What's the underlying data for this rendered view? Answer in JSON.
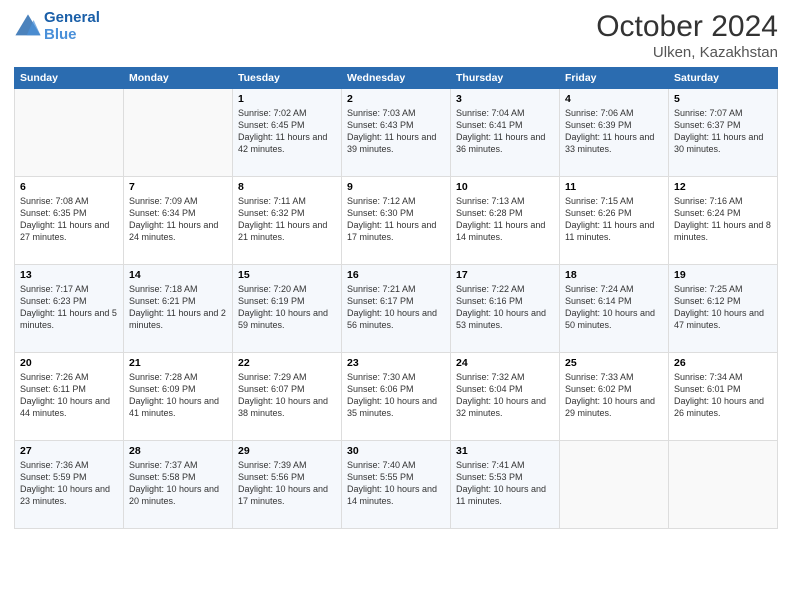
{
  "header": {
    "logo_line1": "General",
    "logo_line2": "Blue",
    "month": "October 2024",
    "location": "Ulken, Kazakhstan"
  },
  "days_of_week": [
    "Sunday",
    "Monday",
    "Tuesday",
    "Wednesday",
    "Thursday",
    "Friday",
    "Saturday"
  ],
  "weeks": [
    [
      {
        "num": "",
        "info": ""
      },
      {
        "num": "",
        "info": ""
      },
      {
        "num": "1",
        "info": "Sunrise: 7:02 AM\nSunset: 6:45 PM\nDaylight: 11 hours and 42 minutes."
      },
      {
        "num": "2",
        "info": "Sunrise: 7:03 AM\nSunset: 6:43 PM\nDaylight: 11 hours and 39 minutes."
      },
      {
        "num": "3",
        "info": "Sunrise: 7:04 AM\nSunset: 6:41 PM\nDaylight: 11 hours and 36 minutes."
      },
      {
        "num": "4",
        "info": "Sunrise: 7:06 AM\nSunset: 6:39 PM\nDaylight: 11 hours and 33 minutes."
      },
      {
        "num": "5",
        "info": "Sunrise: 7:07 AM\nSunset: 6:37 PM\nDaylight: 11 hours and 30 minutes."
      }
    ],
    [
      {
        "num": "6",
        "info": "Sunrise: 7:08 AM\nSunset: 6:35 PM\nDaylight: 11 hours and 27 minutes."
      },
      {
        "num": "7",
        "info": "Sunrise: 7:09 AM\nSunset: 6:34 PM\nDaylight: 11 hours and 24 minutes."
      },
      {
        "num": "8",
        "info": "Sunrise: 7:11 AM\nSunset: 6:32 PM\nDaylight: 11 hours and 21 minutes."
      },
      {
        "num": "9",
        "info": "Sunrise: 7:12 AM\nSunset: 6:30 PM\nDaylight: 11 hours and 17 minutes."
      },
      {
        "num": "10",
        "info": "Sunrise: 7:13 AM\nSunset: 6:28 PM\nDaylight: 11 hours and 14 minutes."
      },
      {
        "num": "11",
        "info": "Sunrise: 7:15 AM\nSunset: 6:26 PM\nDaylight: 11 hours and 11 minutes."
      },
      {
        "num": "12",
        "info": "Sunrise: 7:16 AM\nSunset: 6:24 PM\nDaylight: 11 hours and 8 minutes."
      }
    ],
    [
      {
        "num": "13",
        "info": "Sunrise: 7:17 AM\nSunset: 6:23 PM\nDaylight: 11 hours and 5 minutes."
      },
      {
        "num": "14",
        "info": "Sunrise: 7:18 AM\nSunset: 6:21 PM\nDaylight: 11 hours and 2 minutes."
      },
      {
        "num": "15",
        "info": "Sunrise: 7:20 AM\nSunset: 6:19 PM\nDaylight: 10 hours and 59 minutes."
      },
      {
        "num": "16",
        "info": "Sunrise: 7:21 AM\nSunset: 6:17 PM\nDaylight: 10 hours and 56 minutes."
      },
      {
        "num": "17",
        "info": "Sunrise: 7:22 AM\nSunset: 6:16 PM\nDaylight: 10 hours and 53 minutes."
      },
      {
        "num": "18",
        "info": "Sunrise: 7:24 AM\nSunset: 6:14 PM\nDaylight: 10 hours and 50 minutes."
      },
      {
        "num": "19",
        "info": "Sunrise: 7:25 AM\nSunset: 6:12 PM\nDaylight: 10 hours and 47 minutes."
      }
    ],
    [
      {
        "num": "20",
        "info": "Sunrise: 7:26 AM\nSunset: 6:11 PM\nDaylight: 10 hours and 44 minutes."
      },
      {
        "num": "21",
        "info": "Sunrise: 7:28 AM\nSunset: 6:09 PM\nDaylight: 10 hours and 41 minutes."
      },
      {
        "num": "22",
        "info": "Sunrise: 7:29 AM\nSunset: 6:07 PM\nDaylight: 10 hours and 38 minutes."
      },
      {
        "num": "23",
        "info": "Sunrise: 7:30 AM\nSunset: 6:06 PM\nDaylight: 10 hours and 35 minutes."
      },
      {
        "num": "24",
        "info": "Sunrise: 7:32 AM\nSunset: 6:04 PM\nDaylight: 10 hours and 32 minutes."
      },
      {
        "num": "25",
        "info": "Sunrise: 7:33 AM\nSunset: 6:02 PM\nDaylight: 10 hours and 29 minutes."
      },
      {
        "num": "26",
        "info": "Sunrise: 7:34 AM\nSunset: 6:01 PM\nDaylight: 10 hours and 26 minutes."
      }
    ],
    [
      {
        "num": "27",
        "info": "Sunrise: 7:36 AM\nSunset: 5:59 PM\nDaylight: 10 hours and 23 minutes."
      },
      {
        "num": "28",
        "info": "Sunrise: 7:37 AM\nSunset: 5:58 PM\nDaylight: 10 hours and 20 minutes."
      },
      {
        "num": "29",
        "info": "Sunrise: 7:39 AM\nSunset: 5:56 PM\nDaylight: 10 hours and 17 minutes."
      },
      {
        "num": "30",
        "info": "Sunrise: 7:40 AM\nSunset: 5:55 PM\nDaylight: 10 hours and 14 minutes."
      },
      {
        "num": "31",
        "info": "Sunrise: 7:41 AM\nSunset: 5:53 PM\nDaylight: 10 hours and 11 minutes."
      },
      {
        "num": "",
        "info": ""
      },
      {
        "num": "",
        "info": ""
      }
    ]
  ]
}
